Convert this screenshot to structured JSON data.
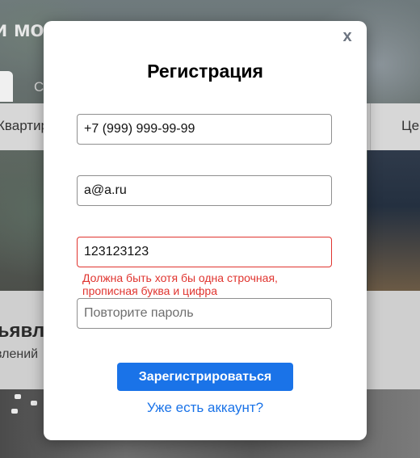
{
  "background": {
    "heading": "и мо",
    "tab": "С",
    "filter_left": "Квартир",
    "filter_right": "Це",
    "section_title": "ъявле",
    "section_subtitle": "влений"
  },
  "modal": {
    "close": "x",
    "title": "Регистрация",
    "phone_value": "+7 (999) 999-99-99",
    "email_value": "a@a.ru",
    "password_value": "123123123",
    "password_error": "Должна быть хотя бы одна строчная, прописная буква и цифра",
    "repeat_placeholder": "Повторите пароль",
    "submit_label": "Зарегистрироваться",
    "login_link": "Уже есть аккаунт?"
  },
  "colors": {
    "accent": "#1a73e8",
    "error": "#e0342f"
  }
}
